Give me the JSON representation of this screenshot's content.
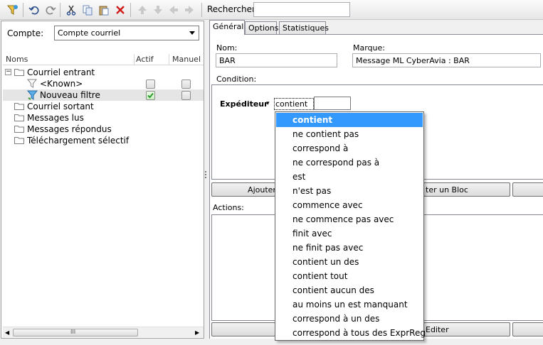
{
  "toolbar": {
    "search_label": "Rechercher",
    "search_value": "",
    "icons": [
      "filter-wizard-icon",
      "undo-icon",
      "redo-icon",
      "cut-icon",
      "copy-icon",
      "paste-icon",
      "delete-icon",
      "move-up-icon",
      "move-down-icon",
      "move-left-icon",
      "move-right-icon"
    ]
  },
  "left_panel": {
    "account_label": "Compte:",
    "account_value": "Compte courriel",
    "columns": {
      "name": "Noms",
      "active": "Actif",
      "manual": "Manuel"
    },
    "tree": [
      {
        "label": "Courriel entrant"
      },
      {
        "label": "<Known>"
      },
      {
        "label": "Nouveau filtre"
      },
      {
        "label": "Courriel sortant"
      },
      {
        "label": "Messages lus"
      },
      {
        "label": "Messages répondus"
      },
      {
        "label": "Téléchargement sélectif"
      }
    ],
    "scroll_grip": "III"
  },
  "tabs": [
    {
      "label": "Général"
    },
    {
      "label": "Options"
    },
    {
      "label": "Statistiques"
    }
  ],
  "general": {
    "name_label": "Nom:",
    "name_value": "BAR",
    "brand_label": "Marque:",
    "brand_value": "Message ML CyberAvia : BAR",
    "condition_label": "Condition:",
    "condition_field": "Expéditeur",
    "condition_op": "contient",
    "condition_value": "",
    "add_button": "Ajouter",
    "add_block_button": "ter un Bloc",
    "actions_label": "Actions:",
    "edit_button": "Editer"
  },
  "dropdown": {
    "selected_index": 0,
    "options": [
      "contient",
      "ne contient pas",
      "correspond à",
      "ne correspond pas à",
      "est",
      "n'est pas",
      "commence avec",
      "ne commence pas avec",
      "finit avec",
      "ne finit pas avec",
      "contient un des",
      "contient tout",
      "contient aucun des",
      "au moins un est manquant",
      "correspond à un des",
      "correspond à tous des ExprReg"
    ]
  },
  "colors": {
    "selection": "#3399ff",
    "check": "#2e9b2e"
  }
}
